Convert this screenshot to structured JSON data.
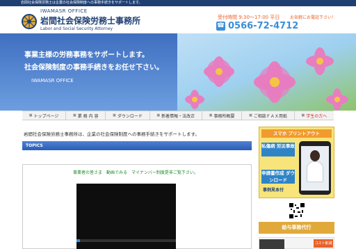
{
  "topbar": {
    "text": "岩間社会保険労務士は企業の社会保険制度への事務手続きをサポートします。"
  },
  "header": {
    "logo_en": "IWAMASR OFFICE",
    "logo_ja": "岩間社会保険労務士事務所",
    "logo_sub": "Labor and Social Security Attorney",
    "hours": "受付時間 9:30～17:00 平日",
    "contact": "お気軽にお電話下さい！",
    "phone": "0566-72-4712"
  },
  "hero": {
    "line1": "事業主様の労務事務をサポートします。",
    "line2": "社会保険制度の事務手続きをお任せ下さい。",
    "office": "IWAMASR OFFICE"
  },
  "nav": {
    "items": [
      {
        "label": "トップページ"
      },
      {
        "label": "業 務 内 容"
      },
      {
        "label": "ダウンロード"
      },
      {
        "label": "新着情報・法改正"
      },
      {
        "label": "事務所概要"
      },
      {
        "label": "ご相談ＦＡＸ用紙"
      },
      {
        "label": "学生の方へ"
      }
    ]
  },
  "main": {
    "greeting": "岩間社会保険労務士事務所は、企業の社会保険制度への事務手続きをサポートします。",
    "topics_label": "TOPICS",
    "video_caption": "事業者の皆さま　動画でみる　マイナンバー制度是非ご覧下さい。"
  },
  "sidebar": {
    "app_title": "スマホ プリントアウト",
    "btn1": "私傷病 労災事故",
    "btn2": "申請書作成 ダウンロード",
    "sample": "事例見本付",
    "payroll": "給与事務代行",
    "thumb_badge": "コスト削減"
  },
  "colors": {
    "navy": "#1f3f73",
    "accent_orange": "#e8622b",
    "phone_blue": "#3a8fd8",
    "caption_green": "#1f8a2a"
  }
}
